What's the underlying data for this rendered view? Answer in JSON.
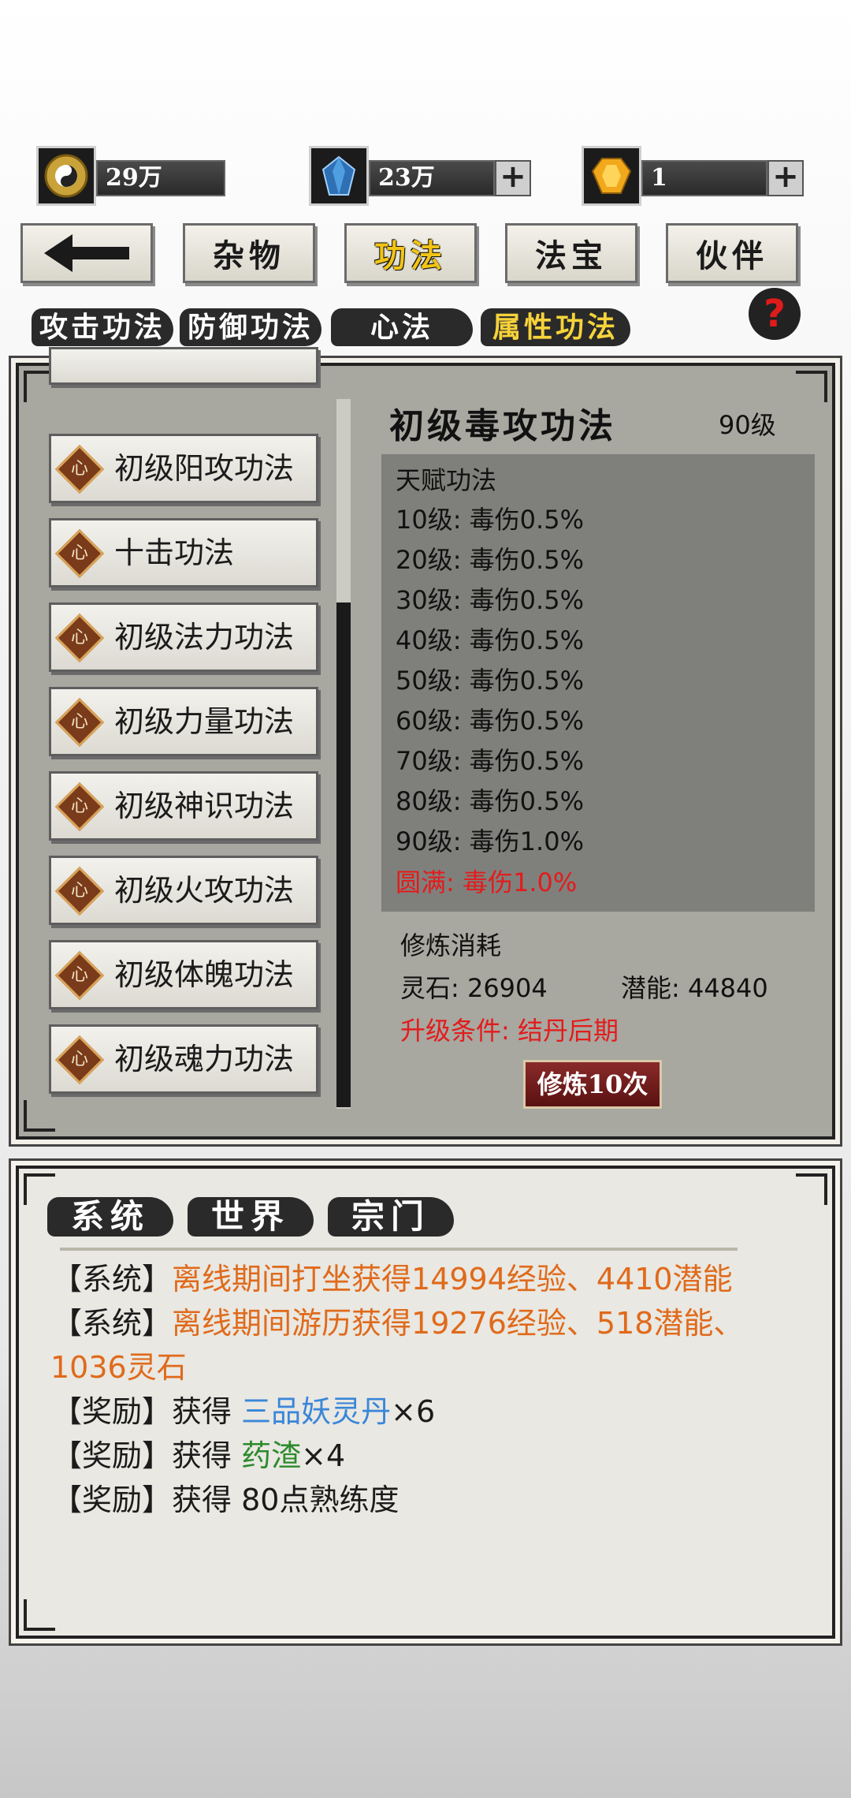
{
  "currency": {
    "first": {
      "icon": "yinyang-coin-icon",
      "value": "29万"
    },
    "second": {
      "icon": "blue-crystal-icon",
      "value": "23万"
    },
    "third": {
      "icon": "gold-gem-icon",
      "value": "1"
    },
    "plus_label": "+"
  },
  "nav": {
    "back_icon": "arrow-left-icon",
    "tabs": [
      "杂物",
      "功法",
      "法宝",
      "伙伴"
    ],
    "active": "功法"
  },
  "subtabs": [
    "攻击功法",
    "防御功法",
    "心法",
    "属性功法"
  ],
  "subtab_active": "属性功法",
  "help_label": "?",
  "list": {
    "icon_char": "心",
    "items": [
      "初级阳攻功法",
      "十击功法",
      "初级法力功法",
      "初级力量功法",
      "初级神识功法",
      "初级火攻功法",
      "初级体魄功法",
      "初级魂力功法"
    ]
  },
  "detail": {
    "title": "初级毒攻功法",
    "level": "90级",
    "talent_header": "天赋功法",
    "talents": [
      "10级: 毒伤0.5%",
      "20级: 毒伤0.5%",
      "30级: 毒伤0.5%",
      "40级: 毒伤0.5%",
      "50级: 毒伤0.5%",
      "60级: 毒伤0.5%",
      "70级: 毒伤0.5%",
      "80级: 毒伤0.5%",
      "90级: 毒伤1.0%"
    ],
    "complete": "圆满: 毒伤1.0%",
    "cost_header": "修炼消耗",
    "stone": "灵石: 26904",
    "potential": "潜能: 44840",
    "condition": "升级条件: 结丹后期",
    "train_button": "修炼10次"
  },
  "chat": {
    "tabs": [
      "系统",
      "世界",
      "宗门"
    ],
    "lines": [
      {
        "prefix": "【系统】",
        "text": "离线期间打坐获得14994经验、4410潜能"
      },
      {
        "prefix": "【系统】",
        "text": "离线期间游历获得19276经验、518潜能、"
      },
      {
        "cont": "1036灵石"
      },
      {
        "prefix": "【奖励】",
        "pre": "获得 ",
        "item": "三品妖灵丹",
        "suffix": "×6"
      },
      {
        "prefix": "【奖励】",
        "pre": "获得 ",
        "item": "药渣",
        "suffix": "×4"
      },
      {
        "prefix": "【奖励】",
        "pre": "获得 80点熟练度"
      }
    ]
  },
  "colors": {
    "active_tab": "#f2c417",
    "red": "#e31b1b",
    "orange": "#e06a1b",
    "blue": "#3a86d9",
    "green": "#2c8a2c"
  }
}
